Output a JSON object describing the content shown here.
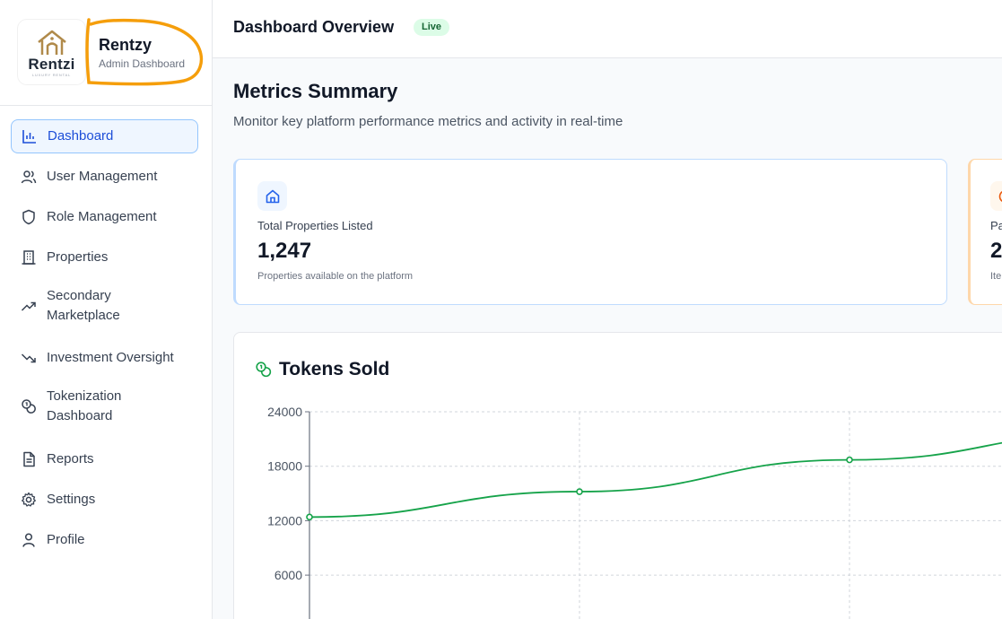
{
  "brand": {
    "logo_text": "Rentzi",
    "logo_tagline": "LUXURY RENTAL",
    "title": "Rentzy",
    "subtitle": "Admin Dashboard"
  },
  "nav": {
    "items": [
      {
        "label": "Dashboard",
        "icon": "bar-chart-icon",
        "active": true
      },
      {
        "label": "User Management",
        "icon": "users-icon",
        "active": false
      },
      {
        "label": "Role Management",
        "icon": "shield-icon",
        "active": false
      },
      {
        "label": "Properties",
        "icon": "building-icon",
        "active": false
      },
      {
        "label_line1": "Secondary",
        "label_line2": "Marketplace",
        "icon": "trending-up-icon",
        "active": false
      },
      {
        "label": "Investment Oversight",
        "icon": "trending-down-icon",
        "active": false
      },
      {
        "label_line1": "Tokenization",
        "label_line2": "Dashboard",
        "icon": "coins-icon",
        "active": false
      },
      {
        "label": "Reports",
        "icon": "file-text-icon",
        "active": false
      },
      {
        "label": "Settings",
        "icon": "gear-icon",
        "active": false
      },
      {
        "label": "Profile",
        "icon": "user-icon",
        "active": false
      }
    ]
  },
  "header": {
    "title": "Dashboard Overview",
    "badge": "Live"
  },
  "main": {
    "title": "Metrics Summary",
    "subtitle": "Monitor key platform performance metrics and activity in real-time"
  },
  "cards": [
    {
      "label": "Total Properties Listed",
      "value": "1,247",
      "note": "Properties available on the platform",
      "icon": "home-icon",
      "accent": "#bfdbfe"
    },
    {
      "label": "Pa",
      "value": "2",
      "note": "Ite",
      "icon": "clock-icon",
      "accent": "#fed7aa"
    }
  ],
  "chart": {
    "title": "Tokens Sold",
    "icon": "coins-icon",
    "color": "#16a34a"
  },
  "chart_data": {
    "type": "line",
    "title": "Tokens Sold",
    "xlabel": "",
    "ylabel": "",
    "ylim": [
      0,
      24000
    ],
    "y_ticks": [
      "24000",
      "18000",
      "12000",
      "6000"
    ],
    "x": [
      0,
      1,
      2,
      3
    ],
    "series": [
      {
        "values": [
          12400,
          15200,
          18700,
          21700
        ]
      }
    ],
    "grid": true
  }
}
